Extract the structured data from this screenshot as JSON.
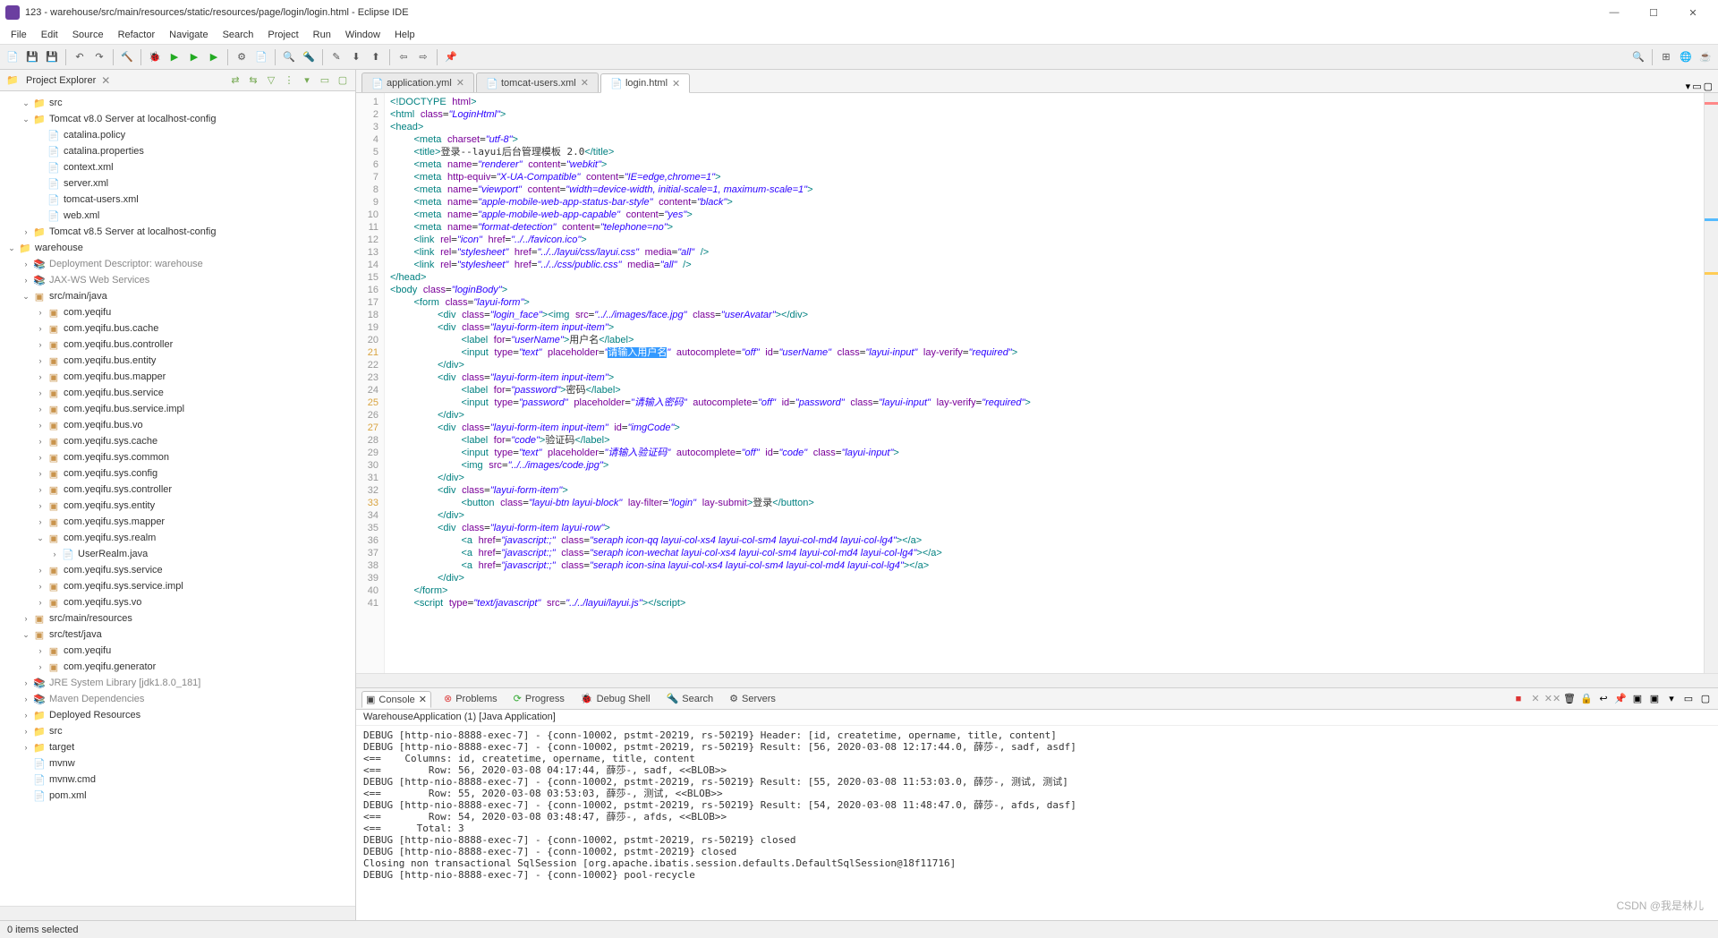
{
  "window": {
    "title": "123 - warehouse/src/main/resources/static/resources/page/login/login.html - Eclipse IDE",
    "min": "—",
    "max": "☐",
    "close": "✕"
  },
  "menu": [
    "File",
    "Edit",
    "Source",
    "Refactor",
    "Navigate",
    "Search",
    "Project",
    "Run",
    "Window",
    "Help"
  ],
  "sidebar": {
    "title": "Project Explorer",
    "tree": [
      {
        "d": 1,
        "t": "v",
        "i": "fld",
        "l": "src"
      },
      {
        "d": 1,
        "t": "v",
        "i": "fld",
        "l": "Tomcat v8.0 Server at localhost-config"
      },
      {
        "d": 2,
        "t": "",
        "i": "xml",
        "l": "catalina.policy"
      },
      {
        "d": 2,
        "t": "",
        "i": "xml",
        "l": "catalina.properties"
      },
      {
        "d": 2,
        "t": "",
        "i": "xml",
        "l": "context.xml"
      },
      {
        "d": 2,
        "t": "",
        "i": "xml",
        "l": "server.xml"
      },
      {
        "d": 2,
        "t": "",
        "i": "xml",
        "l": "tomcat-users.xml"
      },
      {
        "d": 2,
        "t": "",
        "i": "xml",
        "l": "web.xml"
      },
      {
        "d": 1,
        "t": ">",
        "i": "fld",
        "l": "Tomcat v8.5 Server at localhost-config"
      },
      {
        "d": 0,
        "t": "v",
        "i": "fld",
        "l": "warehouse"
      },
      {
        "d": 1,
        "t": ">",
        "i": "jar",
        "l": "Deployment Descriptor: warehouse"
      },
      {
        "d": 1,
        "t": ">",
        "i": "jar",
        "l": "JAX-WS Web Services"
      },
      {
        "d": 1,
        "t": "v",
        "i": "pkg",
        "l": "src/main/java"
      },
      {
        "d": 2,
        "t": ">",
        "i": "pkg",
        "l": "com.yeqifu"
      },
      {
        "d": 2,
        "t": ">",
        "i": "pkg",
        "l": "com.yeqifu.bus.cache"
      },
      {
        "d": 2,
        "t": ">",
        "i": "pkg",
        "l": "com.yeqifu.bus.controller"
      },
      {
        "d": 2,
        "t": ">",
        "i": "pkg",
        "l": "com.yeqifu.bus.entity"
      },
      {
        "d": 2,
        "t": ">",
        "i": "pkg",
        "l": "com.yeqifu.bus.mapper"
      },
      {
        "d": 2,
        "t": ">",
        "i": "pkg",
        "l": "com.yeqifu.bus.service"
      },
      {
        "d": 2,
        "t": ">",
        "i": "pkg",
        "l": "com.yeqifu.bus.service.impl"
      },
      {
        "d": 2,
        "t": ">",
        "i": "pkg",
        "l": "com.yeqifu.bus.vo"
      },
      {
        "d": 2,
        "t": ">",
        "i": "pkg",
        "l": "com.yeqifu.sys.cache"
      },
      {
        "d": 2,
        "t": ">",
        "i": "pkg",
        "l": "com.yeqifu.sys.common"
      },
      {
        "d": 2,
        "t": ">",
        "i": "pkg",
        "l": "com.yeqifu.sys.config"
      },
      {
        "d": 2,
        "t": ">",
        "i": "pkg",
        "l": "com.yeqifu.sys.controller"
      },
      {
        "d": 2,
        "t": ">",
        "i": "pkg",
        "l": "com.yeqifu.sys.entity"
      },
      {
        "d": 2,
        "t": ">",
        "i": "pkg",
        "l": "com.yeqifu.sys.mapper"
      },
      {
        "d": 2,
        "t": "v",
        "i": "pkg",
        "l": "com.yeqifu.sys.realm"
      },
      {
        "d": 3,
        "t": ">",
        "i": "jav",
        "l": "UserRealm.java"
      },
      {
        "d": 2,
        "t": ">",
        "i": "pkg",
        "l": "com.yeqifu.sys.service"
      },
      {
        "d": 2,
        "t": ">",
        "i": "pkg",
        "l": "com.yeqifu.sys.service.impl"
      },
      {
        "d": 2,
        "t": ">",
        "i": "pkg",
        "l": "com.yeqifu.sys.vo"
      },
      {
        "d": 1,
        "t": ">",
        "i": "pkg",
        "l": "src/main/resources"
      },
      {
        "d": 1,
        "t": "v",
        "i": "pkg",
        "l": "src/test/java"
      },
      {
        "d": 2,
        "t": ">",
        "i": "pkg",
        "l": "com.yeqifu"
      },
      {
        "d": 2,
        "t": ">",
        "i": "pkg",
        "l": "com.yeqifu.generator"
      },
      {
        "d": 1,
        "t": ">",
        "i": "jar",
        "l": "JRE System Library [jdk1.8.0_181]"
      },
      {
        "d": 1,
        "t": ">",
        "i": "jar",
        "l": "Maven Dependencies"
      },
      {
        "d": 1,
        "t": ">",
        "i": "fld",
        "l": "Deployed Resources"
      },
      {
        "d": 1,
        "t": ">",
        "i": "fld",
        "l": "src"
      },
      {
        "d": 1,
        "t": ">",
        "i": "fld",
        "l": "target"
      },
      {
        "d": 1,
        "t": "",
        "i": "xml",
        "l": "mvnw"
      },
      {
        "d": 1,
        "t": "",
        "i": "xml",
        "l": "mvnw.cmd"
      },
      {
        "d": 1,
        "t": "",
        "i": "xml",
        "l": "pom.xml"
      }
    ]
  },
  "tabs": [
    {
      "label": "application.yml",
      "active": false
    },
    {
      "label": "tomcat-users.xml",
      "active": false
    },
    {
      "label": "login.html",
      "active": true
    }
  ],
  "editor_lines": [
    "1",
    "2",
    "3",
    "4",
    "5",
    "6",
    "7",
    "8",
    "9",
    "10",
    "11",
    "12",
    "13",
    "14",
    "15",
    "16",
    "17",
    "18",
    "19",
    "20",
    "21",
    "22",
    "23",
    "24",
    "25",
    "26",
    "27",
    "28",
    "29",
    "30",
    "31",
    "32",
    "33",
    "34",
    "35",
    "36",
    "37",
    "38",
    "39",
    "40",
    "41"
  ],
  "bottom_tabs": [
    "Console",
    "Problems",
    "Progress",
    "Debug Shell",
    "Search",
    "Servers"
  ],
  "bottom_sub": "WarehouseApplication (1) [Java Application]",
  "console_lines": [
    "DEBUG [http-nio-8888-exec-7] - {conn-10002, pstmt-20219, rs-50219} Header: [id, createtime, opername, title, content]",
    "DEBUG [http-nio-8888-exec-7] - {conn-10002, pstmt-20219, rs-50219} Result: [56, 2020-03-08 12:17:44.0, 薛莎-, sadf, asdf]",
    "<==    Columns: id, createtime, opername, title, content",
    "<==        Row: 56, 2020-03-08 04:17:44, 薛莎-, sadf, <<BLOB>>",
    "DEBUG [http-nio-8888-exec-7] - {conn-10002, pstmt-20219, rs-50219} Result: [55, 2020-03-08 11:53:03.0, 薛莎-, 测试, 测试]",
    "<==        Row: 55, 2020-03-08 03:53:03, 薛莎-, 测试, <<BLOB>>",
    "DEBUG [http-nio-8888-exec-7] - {conn-10002, pstmt-20219, rs-50219} Result: [54, 2020-03-08 11:48:47.0, 薛莎-, afds, dasf]",
    "<==        Row: 54, 2020-03-08 03:48:47, 薛莎-, afds, <<BLOB>>",
    "<==      Total: 3",
    "DEBUG [http-nio-8888-exec-7] - {conn-10002, pstmt-20219, rs-50219} closed",
    "DEBUG [http-nio-8888-exec-7] - {conn-10002, pstmt-20219} closed",
    "Closing non transactional SqlSession [org.apache.ibatis.session.defaults.DefaultSqlSession@18f11716]",
    "DEBUG [http-nio-8888-exec-7] - {conn-10002} pool-recycle"
  ],
  "status": "0 items selected",
  "watermark": "CSDN @我是林儿"
}
